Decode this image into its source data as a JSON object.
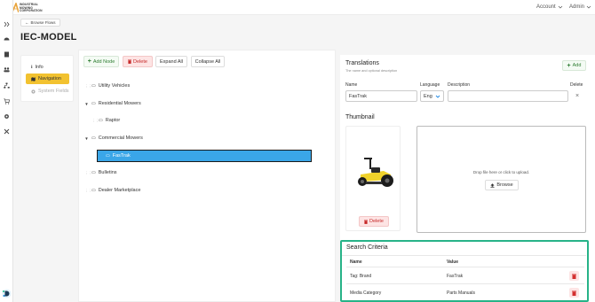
{
  "header": {
    "logo_line1": "INDUSTRIAL",
    "logo_line2": "MOWING",
    "logo_line3": "CORPORATION",
    "account_label": "Account",
    "admin_label": "Admin"
  },
  "breadcrumb": {
    "label": "Browse Flows"
  },
  "page": {
    "title": "IEC-MODEL"
  },
  "sidenav": {
    "items": [
      {
        "label": "Info",
        "icon": "info-icon"
      },
      {
        "label": "Navigation",
        "icon": "map-icon"
      },
      {
        "label": "System Fields",
        "icon": "gear-icon"
      }
    ]
  },
  "toolbar": {
    "add_node": "Add Node",
    "delete": "Delete",
    "expand_all": "Expand All",
    "collapse_all": "Collapse All"
  },
  "tree": {
    "nodes": [
      {
        "label": "Utility Vehicles"
      },
      {
        "label": "Residential Mowers"
      },
      {
        "label": "Raptor"
      },
      {
        "label": "Commercial Mowers"
      },
      {
        "label": "FasTrak"
      },
      {
        "label": "Bulletins"
      },
      {
        "label": "Dealer Marketplace"
      }
    ]
  },
  "translations": {
    "title": "Translations",
    "subtitle": "The name and optional description",
    "add_label": "Add",
    "col_name": "Name",
    "col_language": "Language",
    "col_description": "Description",
    "col_delete": "Delete",
    "name_value": "FasTrak",
    "language_value": "Eng",
    "description_value": ""
  },
  "thumbnail": {
    "title": "Thumbnail",
    "delete_label": "Delete",
    "drop_text": "Drop file here or click to upload.",
    "browse_label": "Browse"
  },
  "search_criteria": {
    "title": "Search Criteria",
    "col_name": "Name",
    "col_value": "Value",
    "rows": [
      {
        "name": "Tag: Brand",
        "value": "FasTrak"
      },
      {
        "name": "Media Category",
        "value": "Parts Manuals"
      }
    ]
  },
  "colors": {
    "accent_yellow": "#f2c230",
    "selection_blue": "#3aa6e8",
    "highlight_green": "#27b388",
    "danger_red": "#d32f2f"
  }
}
